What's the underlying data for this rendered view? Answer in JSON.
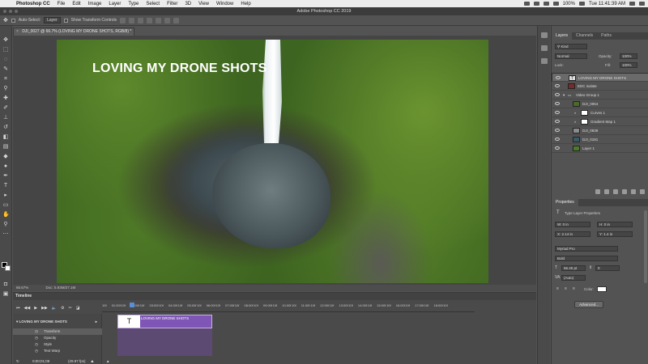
{
  "menubar": {
    "app": "Photoshop CC",
    "items": [
      "File",
      "Edit",
      "Image",
      "Layer",
      "Type",
      "Select",
      "Filter",
      "3D",
      "View",
      "Window",
      "Help"
    ],
    "battery": "100%",
    "clock": "Tue 11:41:39 AM"
  },
  "titlebar": {
    "title": "Adobe Photoshop CC 2019"
  },
  "options": {
    "auto_select_label": "Auto-Select:",
    "auto_select_value": "Layer",
    "transform_label": "Show Transform Controls"
  },
  "document": {
    "tab_title": "DJI_0027 @ 66.7% (LOVING MY DRONE SHOTS, RGB/8) *",
    "overlay_text": "LOVING MY DRONE SHOTS",
    "zoom": "66.67%",
    "doc_size": "Doc: 5.93M/27.1M"
  },
  "timeline": {
    "title": "Timeline",
    "group_name": "LOVING MY DRONE SHOTS",
    "sub_rows": [
      "Transform",
      "Opacity",
      "Style",
      "Text Warp"
    ],
    "clip_label": "LOVING MY DRONE SHOTS",
    "clip_thumb": "T",
    "timecode": "0;00;01;08",
    "fps": "(29.97 fps)",
    "ruler": [
      "10f",
      "01:00f",
      "10f",
      "02:00f",
      "10f",
      "03:00f",
      "10f",
      "04:00f",
      "10f",
      "05:00f",
      "10f",
      "06:00f",
      "10f",
      "07:00f",
      "10f",
      "08:00f",
      "10f",
      "09:00f",
      "10f",
      "10:00f",
      "10f",
      "11:00f",
      "10f",
      "12:00f",
      "10f",
      "13:00f",
      "10f",
      "14:00f",
      "10f",
      "15:00f",
      "10f",
      "16:00f",
      "10f",
      "17:00f",
      "10f",
      "18:00f",
      "10f"
    ]
  },
  "panels": {
    "tabs": [
      "Layers",
      "Channels",
      "Paths"
    ],
    "kind": "Kind",
    "blend_mode": "Normal",
    "opacity_label": "Opacity:",
    "opacity_value": "100%",
    "lock_label": "Lock:",
    "fill_label": "Fill:",
    "fill_value": "100%",
    "layers": [
      {
        "name": "LOVING MY DRONE SHOTS",
        "indent": 0,
        "thumb": "T",
        "selected": true
      },
      {
        "name": "EDC isolate",
        "indent": 0,
        "thumb": "",
        "selected": false
      },
      {
        "name": "Video Group 1",
        "indent": 0,
        "thumb": "folder",
        "selected": false
      },
      {
        "name": "DJI_0064",
        "indent": 1,
        "thumb": "",
        "selected": false
      },
      {
        "name": "Curves 1",
        "indent": 2,
        "thumb": "adj",
        "selected": false
      },
      {
        "name": "Gradient Map 1",
        "indent": 2,
        "thumb": "adj",
        "selected": false
      },
      {
        "name": "DJI_0839",
        "indent": 1,
        "thumb": "",
        "selected": false
      },
      {
        "name": "DJI_0181",
        "indent": 1,
        "thumb": "",
        "selected": false
      },
      {
        "name": "Layer 1",
        "indent": 1,
        "thumb": "",
        "selected": false
      }
    ],
    "properties_title": "Properties",
    "props_subtitle": "Type Layer Properties",
    "w_value": "W: 0 in",
    "h_value": "H: 0 in",
    "x_value": "X: 2.14 in",
    "y_value": "Y: 1.4 in",
    "font_family": "Myriad Pro",
    "font_style": "Bold",
    "font_size": "56.45 pt",
    "leading": "0",
    "tracking": "(Auto)",
    "color_label": "Color:",
    "advanced_label": "Advanced..."
  }
}
